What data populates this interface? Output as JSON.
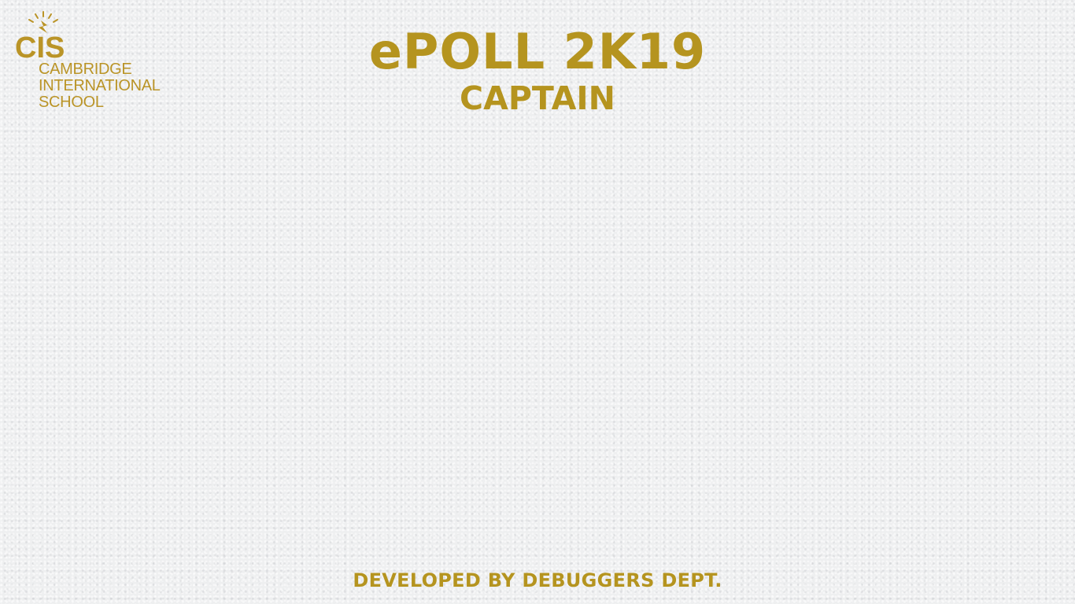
{
  "logo": {
    "mark": "CIS",
    "lines": [
      "CAMBRIDGE",
      "INTERNATIONAL",
      "SCHOOL"
    ]
  },
  "header": {
    "title": "ePOLL 2K19",
    "subtitle": "CAPTAIN"
  },
  "footer": {
    "credit": "DEVELOPED BY DEBUGGERS DEPT."
  },
  "colors": {
    "brand_gold": "#b5941f",
    "background": "#eeeff0"
  }
}
